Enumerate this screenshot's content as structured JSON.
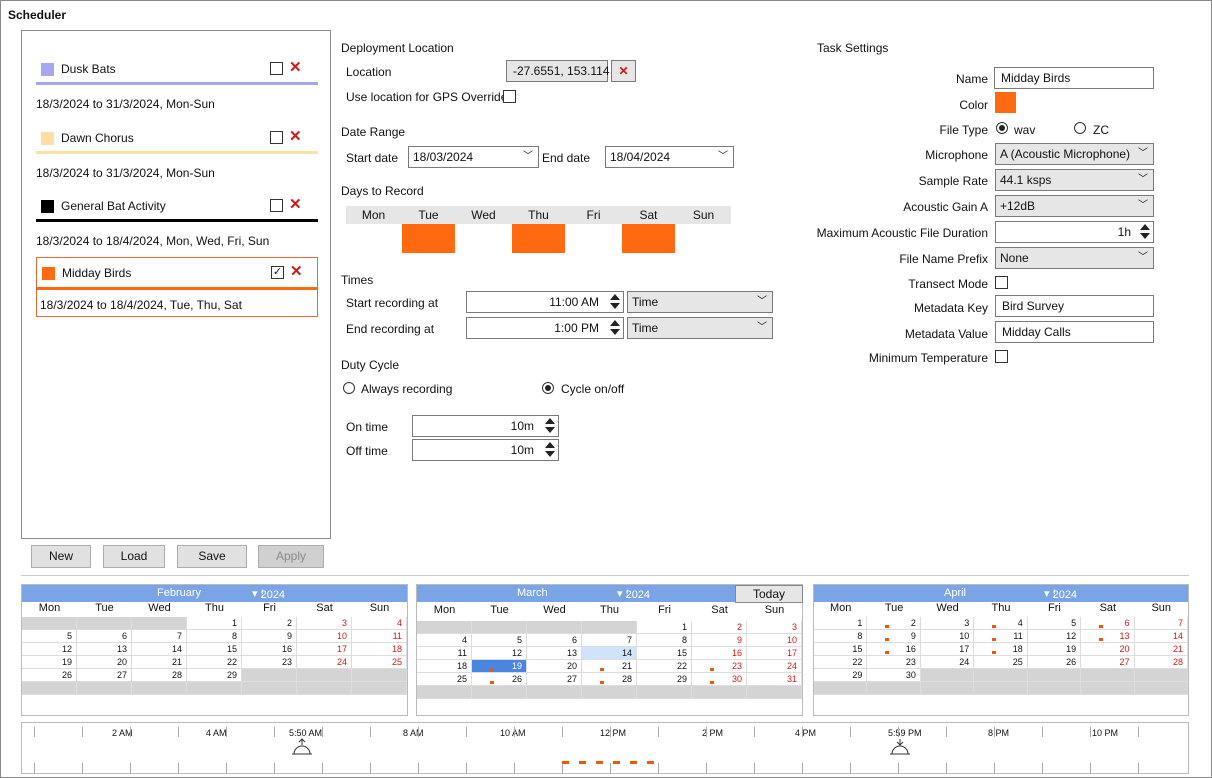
{
  "window": {
    "title": "Scheduler"
  },
  "tasks": [
    {
      "name": "Dusk Bats",
      "color": "#a7a7f0",
      "checked": false,
      "desc": "18/3/2024 to 31/3/2024, Mon-Sun"
    },
    {
      "name": "Dawn Chorus",
      "color": "#fde0a8",
      "checked": false,
      "desc": "18/3/2024 to 31/3/2024, Mon-Sun"
    },
    {
      "name": "General Bat Activity",
      "color": "#000000",
      "checked": false,
      "desc": "18/3/2024 to 18/4/2024, Mon, Wed, Fri, Sun"
    },
    {
      "name": "Midday Birds",
      "color": "#ff6a10",
      "checked": true,
      "desc": "18/3/2024 to 18/4/2024, Tue, Thu, Sat"
    }
  ],
  "buttons": {
    "new": "New",
    "load": "Load",
    "save": "Save",
    "apply": "Apply"
  },
  "deployment": {
    "heading": "Deployment Location",
    "location_label": "Location",
    "location_value": "-27.6551, 153.114",
    "gps_label": "Use location for GPS Override"
  },
  "date_range": {
    "heading": "Date Range",
    "start_label": "Start date",
    "start_value": "18/03/2024",
    "end_label": "End date",
    "end_value": "18/04/2024"
  },
  "days": {
    "heading": "Days to Record",
    "names": [
      "Mon",
      "Tue",
      "Wed",
      "Thu",
      "Fri",
      "Sat",
      "Sun"
    ],
    "selected": [
      false,
      true,
      false,
      true,
      false,
      true,
      false
    ]
  },
  "times": {
    "heading": "Times",
    "start_label": "Start recording at",
    "start_value": "11:00 AM",
    "start_mode": "Time",
    "end_label": "End recording at",
    "end_value": "1:00 PM",
    "end_mode": "Time"
  },
  "duty": {
    "heading": "Duty Cycle",
    "always": "Always recording",
    "cycle": "Cycle on/off",
    "on_label": "On time",
    "on_value": "10m",
    "off_label": "Off time",
    "off_value": "10m"
  },
  "settings": {
    "heading": "Task Settings",
    "name_label": "Name",
    "name_value": "Midday Birds",
    "color_label": "Color",
    "color_value": "#ff6a10",
    "filetype_label": "File Type",
    "wav": "wav",
    "zc": "ZC",
    "mic_label": "Microphone",
    "mic_value": "A (Acoustic Microphone)",
    "rate_label": "Sample Rate",
    "rate_value": "44.1 ksps",
    "gain_label": "Acoustic Gain A",
    "gain_value": "+12dB",
    "dur_label": "Maximum Acoustic File Duration",
    "dur_value": "1h",
    "prefix_label": "File Name Prefix",
    "prefix_value": "None",
    "transect_label": "Transect Mode",
    "key_label": "Metadata Key",
    "key_value": "Bird Survey",
    "value_label": "Metadata Value",
    "value_value": "Midday Calls",
    "mintemp_label": "Minimum Temperature"
  },
  "calendars": [
    {
      "month": "February",
      "year": "2024",
      "dow": [
        "Mon",
        "Tue",
        "Wed",
        "Thu",
        "Fri",
        "Sat",
        "Sun"
      ],
      "startcol": 3,
      "days": 29,
      "today": false
    },
    {
      "month": "March",
      "year": "2024",
      "dow": [
        "Mon",
        "Tue",
        "Wed",
        "Thu",
        "Fri",
        "Sat",
        "Sun"
      ],
      "startcol": 4,
      "days": 31,
      "today": true,
      "today_label": "Today"
    },
    {
      "month": "April",
      "year": "2024",
      "dow": [
        "Mon",
        "Tue",
        "Wed",
        "Thu",
        "Fri",
        "Sat",
        "Sun"
      ],
      "startcol": 0,
      "days": 30,
      "today": false
    }
  ],
  "timeline": {
    "labels": [
      "2 AM",
      "4 AM",
      "5:50 AM",
      "8 AM",
      "10 AM",
      "12 PM",
      "2 PM",
      "4 PM",
      "5:59 PM",
      "8 PM",
      "10 PM"
    ]
  }
}
